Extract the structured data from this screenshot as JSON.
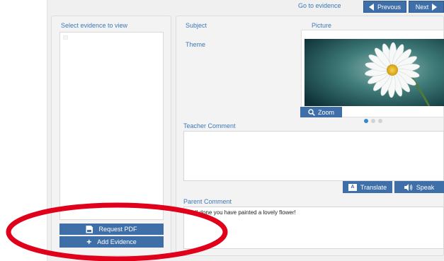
{
  "nav": {
    "goto_label": "Go to evidence",
    "prev_label": "Prevous",
    "next_label": "Next"
  },
  "left": {
    "title": "Select evidence to view",
    "request_pdf_label": "Request PDF",
    "add_evidence_label": "Add Evidence"
  },
  "detail": {
    "subject_label": "Subject",
    "theme_label": "Theme",
    "picture_label": "Picture",
    "zoom_label": "Zoom",
    "carousel_active_index": 0,
    "teacher_comment_label": "Teacher Comment",
    "teacher_comment_value": "",
    "translate_label": "Translate",
    "speak_label": "Speak",
    "parent_comment_label": "Parent Comment",
    "parent_comment_value": "Well done you have painted a lovely flower!"
  },
  "colors": {
    "accent": "#3f6fa8",
    "link": "#3d78b8",
    "annotation": "#e0001b"
  },
  "icons": [
    "prev-arrow-icon",
    "next-arrow-icon",
    "pdf-icon",
    "plus-icon",
    "search-icon",
    "translate-icon",
    "speaker-icon"
  ]
}
